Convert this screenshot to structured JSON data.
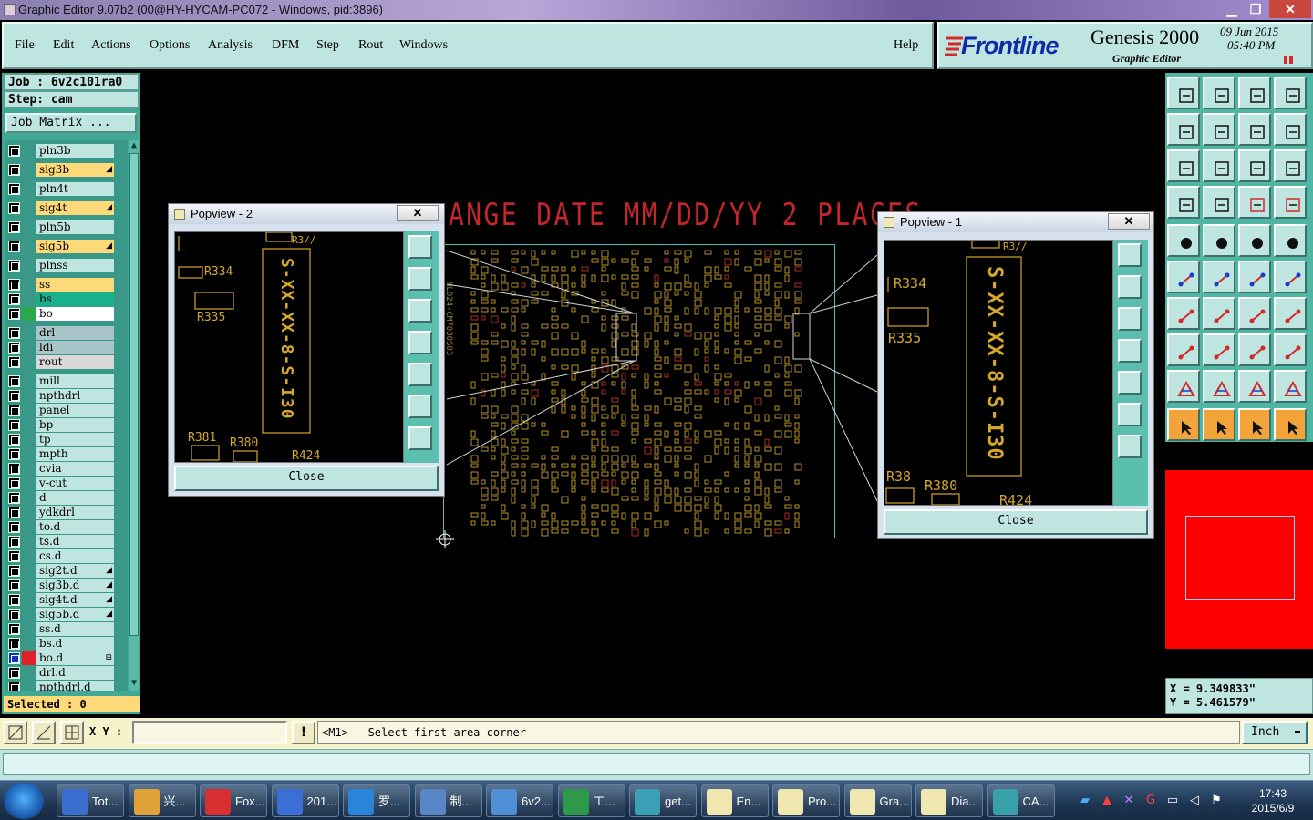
{
  "window": {
    "title": "Graphic Editor 9.07b2 (00@HY-HYCAM-PC072 - Windows, pid:3896)",
    "minimize": "▁",
    "restore": "❐",
    "close": "✕"
  },
  "menu": [
    "File",
    "Edit",
    "Actions",
    "Options",
    "Analysis",
    "DFM",
    "Step",
    "Rout",
    "Windows"
  ],
  "help_label": "Help",
  "brand": {
    "logo_text": "Frontline",
    "product": "Genesis 2000",
    "subtitle": "Graphic Editor",
    "date": "09 Jun 2015",
    "time": "05:40 PM"
  },
  "job": {
    "job_label": "Job : 6v2c101ra0",
    "step_label": "Step: cam",
    "job_matrix_label": "Job Matrix ..."
  },
  "layers": [
    {
      "name": "pln3b",
      "color": "#bfe5e1",
      "swatch": "",
      "mark": ""
    },
    {
      "name": "sig3b",
      "color": "#fdd97a",
      "swatch": "",
      "mark": "◢"
    },
    {
      "name": "pln4t",
      "color": "#bfe5e1",
      "swatch": "",
      "mark": ""
    },
    {
      "name": "sig4t",
      "color": "#fdd97a",
      "swatch": "",
      "mark": "◢"
    },
    {
      "name": "pln5b",
      "color": "#bfe5e1",
      "swatch": "",
      "mark": ""
    },
    {
      "name": "sig5b",
      "color": "#fdd97a",
      "swatch": "",
      "mark": "◢"
    },
    {
      "name": "plnss",
      "color": "#bfe5e1",
      "swatch": "",
      "mark": ""
    },
    {
      "name": "ss",
      "color": "#fdd97a",
      "swatch": "",
      "mark": ""
    },
    {
      "name": "bs",
      "color": "#19b08e",
      "swatch": "",
      "mark": ""
    },
    {
      "name": "bo",
      "color": "#ffffff",
      "swatch": "#2aa84a",
      "mark": ""
    },
    {
      "name": "drl",
      "color": "#a9c4c8",
      "swatch": "",
      "mark": ""
    },
    {
      "name": "ldi",
      "color": "#a9c4c8",
      "swatch": "",
      "mark": ""
    },
    {
      "name": "rout",
      "color": "#d8d8d8",
      "swatch": "",
      "mark": ""
    },
    {
      "name": "mill",
      "color": "#bfe5e1",
      "swatch": "",
      "mark": ""
    },
    {
      "name": "npthdrl",
      "color": "#bfe5e1",
      "swatch": "",
      "mark": ""
    },
    {
      "name": "panel",
      "color": "#bfe5e1",
      "swatch": "",
      "mark": ""
    },
    {
      "name": "bp",
      "color": "#bfe5e1",
      "swatch": "",
      "mark": ""
    },
    {
      "name": "tp",
      "color": "#bfe5e1",
      "swatch": "",
      "mark": ""
    },
    {
      "name": "mpth",
      "color": "#bfe5e1",
      "swatch": "",
      "mark": ""
    },
    {
      "name": "cvia",
      "color": "#bfe5e1",
      "swatch": "",
      "mark": ""
    },
    {
      "name": "v-cut",
      "color": "#bfe5e1",
      "swatch": "",
      "mark": ""
    },
    {
      "name": "d",
      "color": "#bfe5e1",
      "swatch": "",
      "mark": ""
    },
    {
      "name": "ydkdrl",
      "color": "#bfe5e1",
      "swatch": "",
      "mark": ""
    },
    {
      "name": "to.d",
      "color": "#bfe5e1",
      "swatch": "",
      "mark": ""
    },
    {
      "name": "ts.d",
      "color": "#bfe5e1",
      "swatch": "",
      "mark": ""
    },
    {
      "name": "cs.d",
      "color": "#bfe5e1",
      "swatch": "",
      "mark": ""
    },
    {
      "name": "sig2t.d",
      "color": "#bfe5e1",
      "swatch": "",
      "mark": "◢"
    },
    {
      "name": "sig3b.d",
      "color": "#bfe5e1",
      "swatch": "",
      "mark": "◢"
    },
    {
      "name": "sig4t.d",
      "color": "#bfe5e1",
      "swatch": "",
      "mark": "◢"
    },
    {
      "name": "sig5b.d",
      "color": "#bfe5e1",
      "swatch": "",
      "mark": "◢"
    },
    {
      "name": "ss.d",
      "color": "#bfe5e1",
      "swatch": "",
      "mark": ""
    },
    {
      "name": "bs.d",
      "color": "#bfe5e1",
      "swatch": "",
      "mark": ""
    },
    {
      "name": "bo.d",
      "color": "#bfe5e1",
      "swatch": "#e0202a",
      "mark": "⊞"
    },
    {
      "name": "drl.d",
      "color": "#bfe5e1",
      "swatch": "",
      "mark": ""
    },
    {
      "name": "npthdrl.d",
      "color": "#bfe5e1",
      "swatch": "",
      "mark": ""
    }
  ],
  "selected_label": "Selected : 0",
  "canvas": {
    "banner": "ANGE DATE MM/DD/YY 2 PLACES",
    "board_side_text": "MLD24-CM7030S03"
  },
  "popview2": {
    "title": "Popview - 2",
    "close_label": "Close",
    "labels": [
      "R3//",
      "R334",
      "R335",
      "R381",
      "R380",
      "R424"
    ],
    "vtext": "S-XX-XX-8-S-I30"
  },
  "popview1": {
    "title": "Popview - 1",
    "close_label": "Close",
    "labels": [
      "R3//",
      "R334",
      "R335",
      "R38",
      "R380",
      "R424"
    ],
    "vtext": "S-XX-XX-8-S-I30"
  },
  "coords": {
    "x": "X = 9.349833\"",
    "y": "Y = 5.461579\""
  },
  "status": {
    "xy_label": "X Y :",
    "xy_value": "",
    "prompt": "<M1> - Select first area corner",
    "unit": "Inch",
    "bang": "!"
  },
  "taskbar": {
    "items": [
      {
        "label": "Tot...",
        "icon_color": "#3a6fcf",
        "icon": "floppy-icon"
      },
      {
        "label": "兴...",
        "icon_color": "#e2a23a",
        "icon": "shell-icon"
      },
      {
        "label": "Fox...",
        "icon_color": "#d83030",
        "icon": "foxit-icon"
      },
      {
        "label": "201...",
        "icon_color": "#3b6fd6",
        "icon": "word-icon"
      },
      {
        "label": "罗...",
        "icon_color": "#2a84d8",
        "icon": "f-icon"
      },
      {
        "label": "制...",
        "icon_color": "#5a86c8",
        "icon": "list-icon"
      },
      {
        "label": "6v2...",
        "icon_color": "#4f8fd6",
        "icon": "doc-icon"
      },
      {
        "label": "工...",
        "icon_color": "#2d9a4a",
        "icon": "p-icon"
      },
      {
        "label": "get...",
        "icon_color": "#3aa0b8",
        "icon": "eye-icon"
      },
      {
        "label": "En...",
        "icon_color": "#f0e6b0",
        "icon": "x-window-icon"
      },
      {
        "label": "Pro...",
        "icon_color": "#f0e6b0",
        "icon": "x-window-icon"
      },
      {
        "label": "Gra...",
        "icon_color": "#f0e6b0",
        "icon": "x-window-icon"
      },
      {
        "label": "Dia...",
        "icon_color": "#f0e6b0",
        "icon": "x-window-icon"
      },
      {
        "label": "CA...",
        "icon_color": "#38a0a8",
        "icon": "cam-icon"
      }
    ],
    "time": "17:43",
    "date": "2015/6/9"
  }
}
